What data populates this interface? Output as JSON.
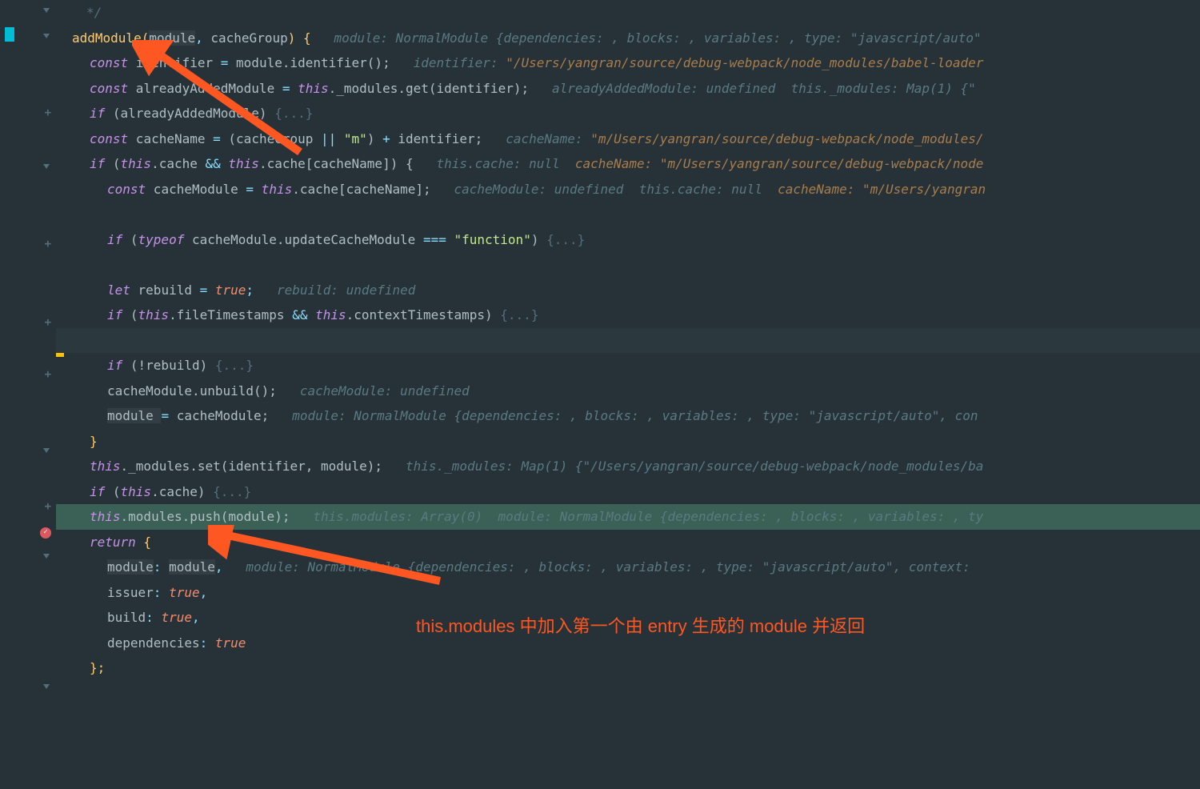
{
  "annotation": "this.modules 中加入第一个由 entry 生成的 module 并返回",
  "lines": {
    "l0": "*/",
    "l1": {
      "code_pre": "addModule(",
      "p1": "module",
      "comma": ", ",
      "p2": "cacheGroup",
      "code_post": ") {",
      "hint": "module: NormalModule {dependencies: , blocks: , variables: , type: \"javascript/auto\""
    },
    "l2": {
      "kw": "const",
      "id": " identifier ",
      "eq": "=",
      "rhs": " module.identifier();",
      "hint_k": "identifier:",
      "hint_v": "\"/Users/yangran/source/debug-webpack/node_modules/babel-loader"
    },
    "l3": {
      "kw": "const",
      "id": " alreadyAddedModule ",
      "eq": "=",
      "th": " this",
      "rhs": "._modules.get(identifier);",
      "hint1": "alreadyAddedModule: undefined",
      "hint2": "this._modules: Map(1) {\""
    },
    "l4": {
      "kw": "if",
      "cond": " (alreadyAddedModule) ",
      "fold": "{...}"
    },
    "l5": {
      "kw": "const",
      "id": " cacheName ",
      "eq": "=",
      "rhs1": " (cacheGroup ",
      "op1": "||",
      "str": " \"m\"",
      "rhs2": ") ",
      "op2": "+",
      "rhs3": " identifier;",
      "hint_k": "cacheName:",
      "hint_v": "\"m/Users/yangran/source/debug-webpack/node_modules/"
    },
    "l6": {
      "kw": "if",
      "open": " (",
      "th1": "this",
      "p1": ".cache ",
      "op": "&&",
      "th2": " this",
      "p2": ".cache[cacheName]) {",
      "hint1": "this.cache: null",
      "hint2": "cacheName: \"m/Users/yangran/source/debug-webpack/node"
    },
    "l7": {
      "kw": "const",
      "id": " cacheModule ",
      "eq": "=",
      "th": " this",
      "rhs": ".cache[cacheName];",
      "hint1": "cacheModule: undefined",
      "hint2": "this.cache: null",
      "hint3": "cacheName: \"m/Users/yangran"
    },
    "l9": {
      "kw": "if",
      "open": " (",
      "to": "typeof",
      "rhs": " cacheModule.updateCacheModule ",
      "eqeq": "===",
      "str": " \"function\"",
      "close": ") ",
      "fold": "{...}"
    },
    "l11": {
      "kw": "let",
      "id": " rebuild ",
      "eq": "=",
      "val": " true",
      "semi": ";",
      "hint": "rebuild: undefined"
    },
    "l12": {
      "kw": "if",
      "open": " (",
      "th1": "this",
      "p1": ".fileTimestamps ",
      "op": "&&",
      "th2": " this",
      "p2": ".contextTimestamps) ",
      "fold": "{...}"
    },
    "l14": {
      "kw": "if",
      "cond": " (!rebuild) ",
      "fold": "{...}"
    },
    "l15": {
      "code": "cacheModule.unbuild();",
      "hint": "cacheModule: undefined"
    },
    "l16": {
      "lhs": "module ",
      "eq": "=",
      "rhs": " cacheModule;",
      "hint": "module: NormalModule {dependencies: , blocks: , variables: , type: \"javascript/auto\", con"
    },
    "l17": "}",
    "l18": {
      "th": "this",
      "rhs": "._modules.set(identifier, module);",
      "hint": "this._modules: Map(1) {\"/Users/yangran/source/debug-webpack/node_modules/ba"
    },
    "l19": {
      "kw": "if",
      "open": " (",
      "th": "this",
      "p": ".cache) ",
      "fold": "{...}"
    },
    "l20": {
      "th": "this",
      "p1": ".modules.push(module);",
      "hint1": "this.modules: Array(0)",
      "hint2": "module: NormalModule {dependencies: , blocks: , variables: , ty"
    },
    "l21": {
      "kw": "return",
      "brace": " {"
    },
    "l22": {
      "key": "module",
      "val": "module",
      "hint": "module: NormalModule {dependencies: , blocks: , variables: , type: \"javascript/auto\", context: "
    },
    "l23": {
      "key": "issuer",
      "val": "true"
    },
    "l24": {
      "key": "build",
      "val": "true"
    },
    "l25": {
      "key": "dependencies",
      "val": "true"
    },
    "l26": "};"
  }
}
